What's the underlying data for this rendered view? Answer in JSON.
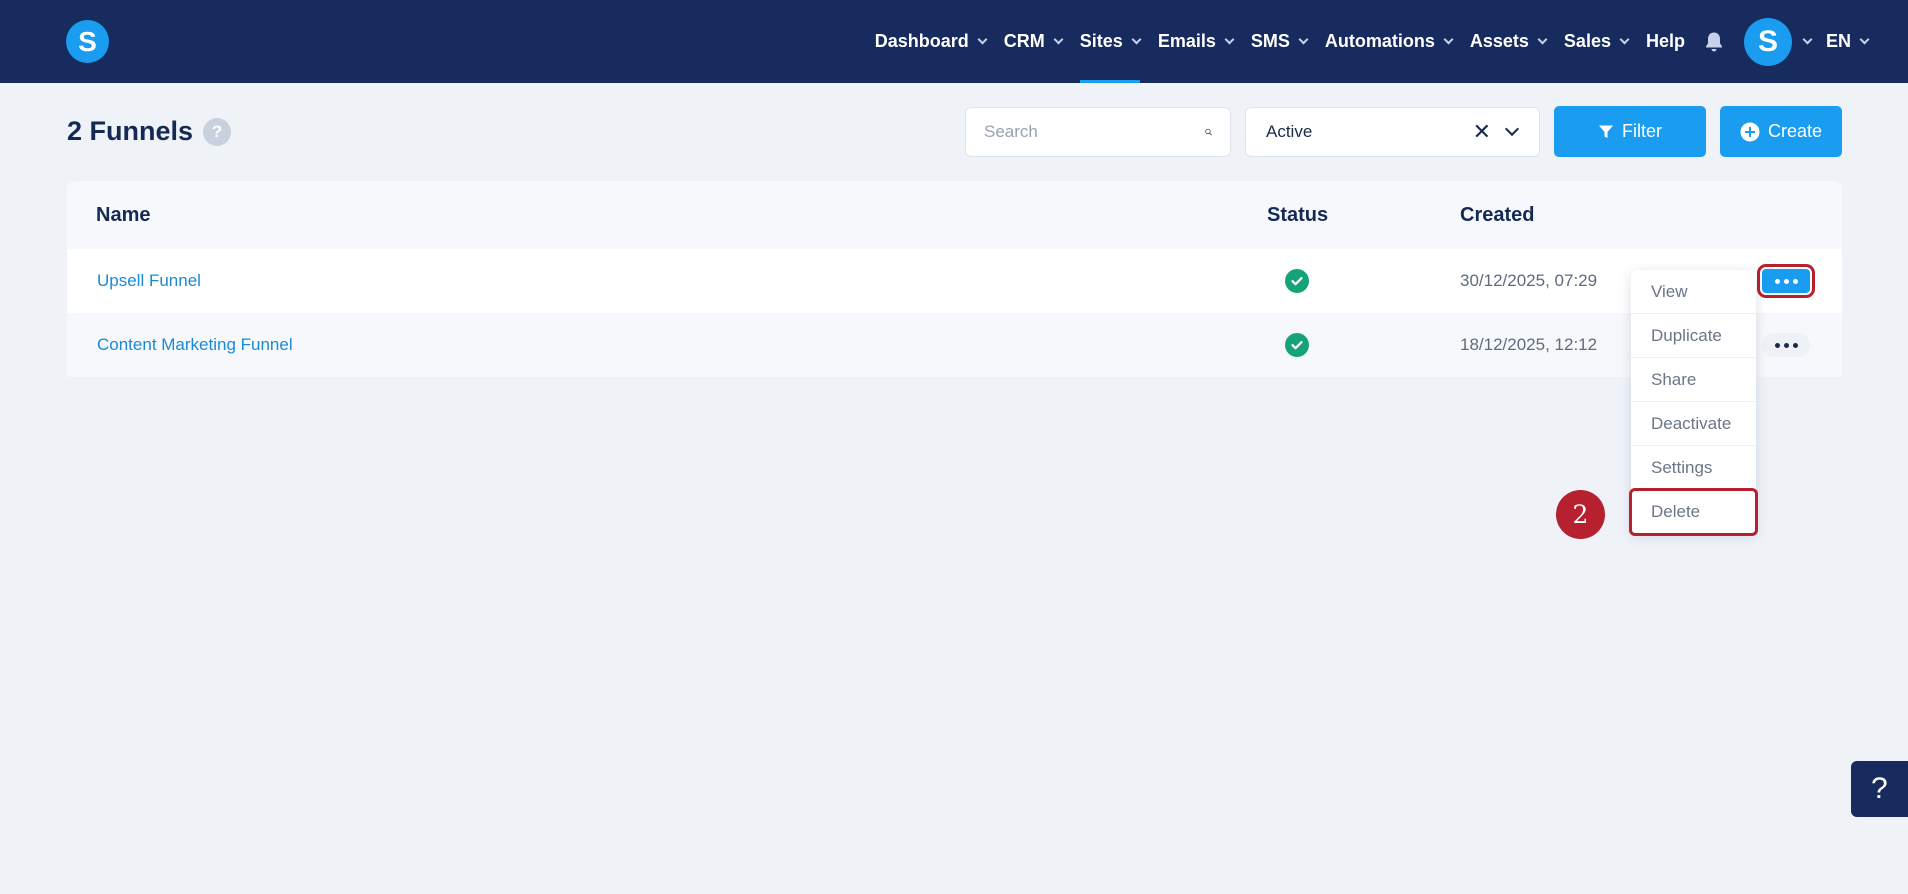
{
  "header": {
    "logo_letter": "S",
    "nav": [
      {
        "label": "Dashboard",
        "active": false
      },
      {
        "label": "CRM",
        "active": false
      },
      {
        "label": "Sites",
        "active": true
      },
      {
        "label": "Emails",
        "active": false
      },
      {
        "label": "SMS",
        "active": false
      },
      {
        "label": "Automations",
        "active": false
      },
      {
        "label": "Assets",
        "active": false
      },
      {
        "label": "Sales",
        "active": false
      }
    ],
    "help_label": "Help",
    "avatar_letter": "S",
    "language": "EN"
  },
  "toolbar": {
    "title": "2 Funnels",
    "help_badge": "?",
    "search_placeholder": "Search",
    "status_filter_value": "Active",
    "filter_label": "Filter",
    "create_label": "Create"
  },
  "table": {
    "columns": [
      "Name",
      "Status",
      "Created"
    ],
    "rows": [
      {
        "name": "Upsell Funnel",
        "status": "active",
        "created": "30/12/2025, 07:29"
      },
      {
        "name": "Content Marketing Funnel",
        "status": "active",
        "created": "18/12/2025, 12:12"
      }
    ]
  },
  "row_menu": {
    "items": [
      "View",
      "Duplicate",
      "Share",
      "Deactivate",
      "Settings",
      "Delete"
    ],
    "highlighted": "Delete"
  },
  "annotation": {
    "step": "2"
  },
  "help_fab": "?",
  "colors": {
    "topbar": "#172b5e",
    "accent": "#1a9cf0",
    "success": "#15a37a",
    "annotation": "#b7202e"
  }
}
